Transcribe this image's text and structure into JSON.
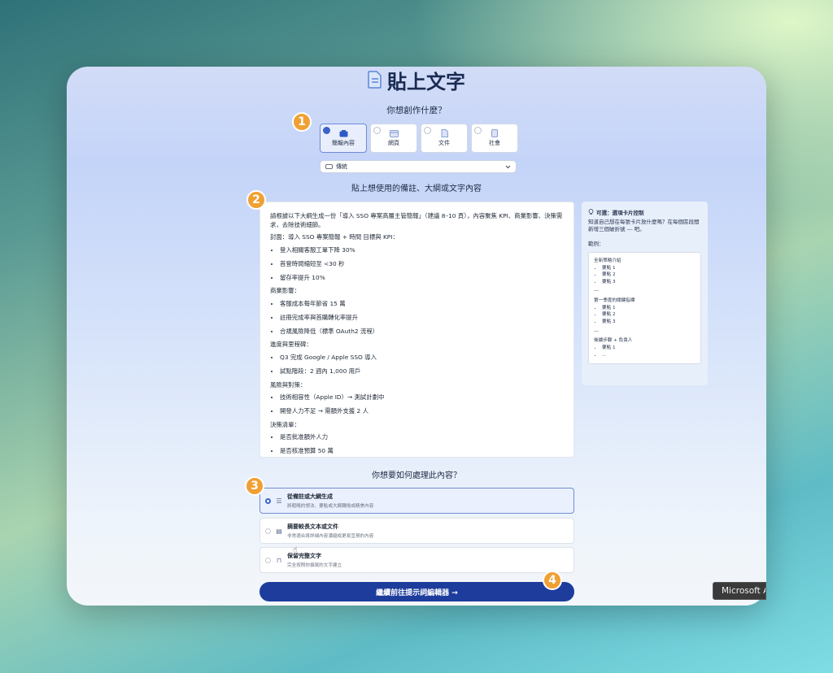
{
  "title": "貼上文字",
  "question_create": "你想創作什麼？",
  "content_types": [
    {
      "label": "簡報內容",
      "selected": true,
      "icon": "presentation-icon"
    },
    {
      "label": "網頁",
      "selected": false,
      "icon": "webpage-icon"
    },
    {
      "label": "文件",
      "selected": false,
      "icon": "document-icon"
    },
    {
      "label": "社會",
      "selected": false,
      "icon": "social-icon"
    }
  ],
  "style_dropdown": {
    "value": "傳統"
  },
  "paste_heading": "貼上想使用的備註、大綱或文字內容",
  "editor": {
    "intro": "請根據以下大綱生成一份「導入 SSO 專案高層主管簡報」（建議 8–10 頁），內容聚焦 KPI、商業影響、決策需求，去除技術細節。",
    "sections": [
      {
        "heading": "封面：導入 SSO 專案簡報 + 時間 目標與 KPI：",
        "items": [
          "登入相關客服工單下降 30%",
          "首登時間縮短至 <30 秒",
          "留存率提升 10%"
        ]
      },
      {
        "heading": "商業影響：",
        "items": [
          "客服成本每年節省 15 萬",
          "註冊完成率與首購轉化率提升",
          "合規風險降低（標準 OAuth2 流程）"
        ]
      },
      {
        "heading": "進度與里程碑：",
        "items": [
          "Q3 完成 Google / Apple SSO 導入",
          "試點階段：2 週內 1,000 用戶"
        ]
      },
      {
        "heading": "風險與對策：",
        "items": [
          "技術相容性（Apple ID）→ 測試計劃中",
          "開發人力不足 → 需額外支援 2 人"
        ]
      },
      {
        "heading": "決策清單：",
        "items": [
          "是否批准額外人力",
          "是否核准預算 50 萬"
        ]
      }
    ]
  },
  "tip": {
    "title": "可選：選項卡片控制",
    "body": "知道自己想在每張卡片放什麼嗎？在每個區段間新增三個破折號 --- 吧。",
    "example_label": "範例：",
    "example": [
      {
        "heading": "全新策略介紹",
        "items": [
          "要點 1",
          "要點 2",
          "要點 3"
        ]
      },
      {
        "heading": "第一季度的關鍵指標",
        "items": [
          "要點 1",
          "要點 2",
          "要點 3"
        ]
      },
      {
        "heading": "後續步驟 + 負責人",
        "items": [
          "要點 1",
          "..."
        ]
      }
    ],
    "separator": "---"
  },
  "process_question": "你想要如何處理此內容？",
  "process_options": [
    {
      "title": "從備註或大綱生成",
      "desc": "將粗略的想法、要點或大綱轉換成精美內容",
      "selected": true,
      "icon": "list-icon"
    },
    {
      "title": "摘要較長文本或文件",
      "desc": "非常適合將詳細內容濃縮成更易呈現的內容",
      "selected": false,
      "icon": "file-icon"
    },
    {
      "title": "保留完整文字",
      "desc": "完全按照你撰寫的文字建立",
      "selected": false,
      "icon": "lock-icon"
    }
  ],
  "continue_button": "繼續前往提示詞編輯器 →",
  "badges": [
    "1",
    "2",
    "3",
    "4"
  ],
  "tooltip": "Microsoft A",
  "colors": {
    "accent": "#1d3c9c",
    "badge": "#f0a033",
    "selected": "#3b63c9"
  }
}
